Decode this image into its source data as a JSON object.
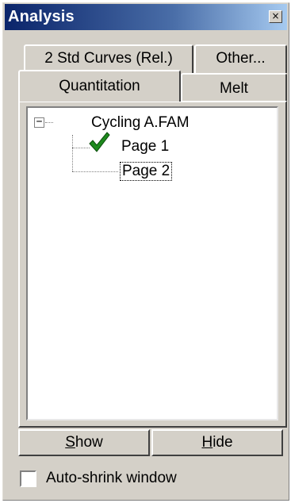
{
  "window": {
    "title": "Analysis",
    "close_glyph": "×"
  },
  "tabs": {
    "back_row": [
      {
        "label": "2 Std Curves (Rel.)"
      },
      {
        "label": "Other..."
      }
    ],
    "front_row": [
      {
        "label": "Quantitation",
        "selected": true
      },
      {
        "label": "Melt",
        "selected": false
      }
    ]
  },
  "tree": {
    "expander": "−",
    "root": "Cycling A.FAM",
    "children": [
      {
        "label": "Page 1",
        "icon": "check-icon",
        "checked": true
      },
      {
        "label": "Page 2",
        "focused": true
      }
    ]
  },
  "buttons": {
    "show": {
      "accel": "S",
      "rest": "how"
    },
    "hide": {
      "accel": "H",
      "rest": "ide"
    }
  },
  "auto_shrink": {
    "label": "Auto-shrink window",
    "checked": false
  },
  "colors": {
    "title_start": "#0a246a",
    "title_end": "#a6caf0",
    "face": "#d4d0c8",
    "check": "#1e8a1e"
  }
}
